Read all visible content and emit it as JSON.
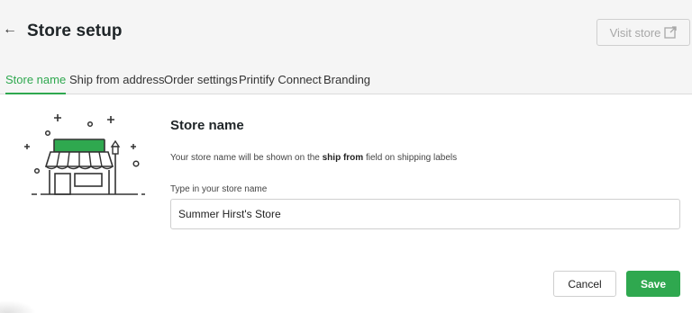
{
  "header": {
    "back_icon": "arrow-left-icon",
    "title": "Store setup",
    "visit_store_label": "Visit store",
    "visit_store_icon": "external-link-icon"
  },
  "tabs": [
    {
      "label": "Store name",
      "active": true
    },
    {
      "label": "Ship from address",
      "active": false
    },
    {
      "label": "Order settings",
      "active": false
    },
    {
      "label": "Printify Connect",
      "active": false
    },
    {
      "label": "Branding",
      "active": false
    }
  ],
  "content": {
    "illustration_icon": "storefront-icon",
    "section_title": "Store name",
    "description_before": "Your store name will be shown on the ",
    "description_bold": "ship from",
    "description_after": " field on shipping labels",
    "field_label": "Type in your store name",
    "store_name_value": "Summer Hirst's Store"
  },
  "actions": {
    "cancel_label": "Cancel",
    "save_label": "Save"
  },
  "colors": {
    "accent": "#2fa84f",
    "background": "#f5f5f5",
    "card": "#ffffff",
    "border": "#cfcfcf"
  }
}
